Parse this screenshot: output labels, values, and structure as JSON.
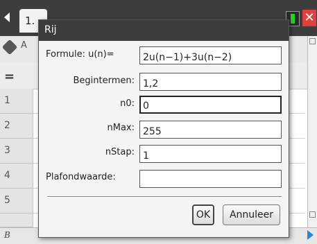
{
  "app": {
    "tab_label": "1.",
    "column_letter": "A",
    "row_numbers": [
      "1",
      "2",
      "3",
      "4",
      "5"
    ],
    "status_cell_ref": "B"
  },
  "dialog": {
    "title": "Rij",
    "fields": [
      {
        "label": "Formule: u(n)=",
        "value": "2u(n−1)+3u(n−2)"
      },
      {
        "label": "Begintermen:",
        "value": "1,2"
      },
      {
        "label": "n0:",
        "value": "0"
      },
      {
        "label": "nMax:",
        "value": "255"
      },
      {
        "label": "nStap:",
        "value": "1"
      },
      {
        "label": "Plafondwaarde:",
        "value": ""
      }
    ],
    "ok_label": "OK",
    "cancel_label": "Annuleer"
  },
  "colors": {
    "title_bar": "#3c3c3c",
    "dialog_bg": "#f4f4f4",
    "close_red": "#e04040",
    "battery_green": "#2ad12a",
    "nav_arrow_blue": "#2a86d9"
  }
}
